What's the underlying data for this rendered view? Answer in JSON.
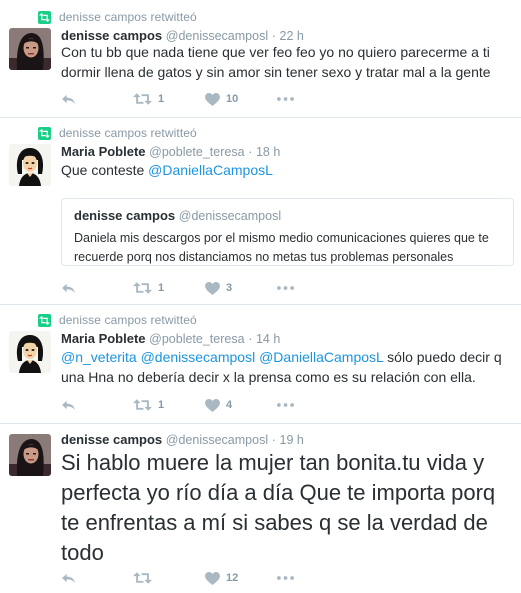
{
  "colors": {
    "link": "#1b95e0",
    "muted": "#8899a6",
    "retweet": "#19cf86",
    "text": "#292f33"
  },
  "tweets": [
    {
      "retweeted_by": "denisse campos retwitteó",
      "name": "denisse campos",
      "handle": "@denissecamposl",
      "time": "22 h",
      "text": "Con tu bb que nada tiene que ver feo feo yo no quiero parecerme a ti dormir llena de gatos y sin amor sin tener sexo y tratar mal a la gente",
      "retweets": "1",
      "likes": "10"
    },
    {
      "retweeted_by": "denisse campos retwitteó",
      "name": "Maria Poblete",
      "handle": "@poblete_teresa",
      "time": "18 h",
      "text": "Que conteste ",
      "mention": "@DaniellaCamposL",
      "quote": {
        "name": "denisse campos",
        "handle": "@denissecamposl",
        "text": "Daniela mis descargos por el mismo medio comunicaciones quieres que te recuerde porq nos distanciamos no metas tus problemas personales"
      },
      "retweets": "1",
      "likes": "3"
    },
    {
      "retweeted_by": "denisse campos retwitteó",
      "name": "Maria Poblete",
      "handle": "@poblete_teresa",
      "time": "14 h",
      "mentions": [
        "@n_veterita",
        "@denissecamposl",
        "@DaniellaCamposL"
      ],
      "text": " sólo puedo decir q una Hna no debería decir x la prensa como es su relación con ella.",
      "retweets": "1",
      "likes": "4"
    },
    {
      "name": "denisse campos",
      "handle": "@denissecamposl",
      "time": "19 h",
      "text": "Si hablo muere la mujer tan bonita.tu vida y perfecta yo río día a día Que te importa porq te enfrentas a mí si sabes q se la verdad de todo",
      "retweets": "",
      "likes": "12"
    }
  ]
}
